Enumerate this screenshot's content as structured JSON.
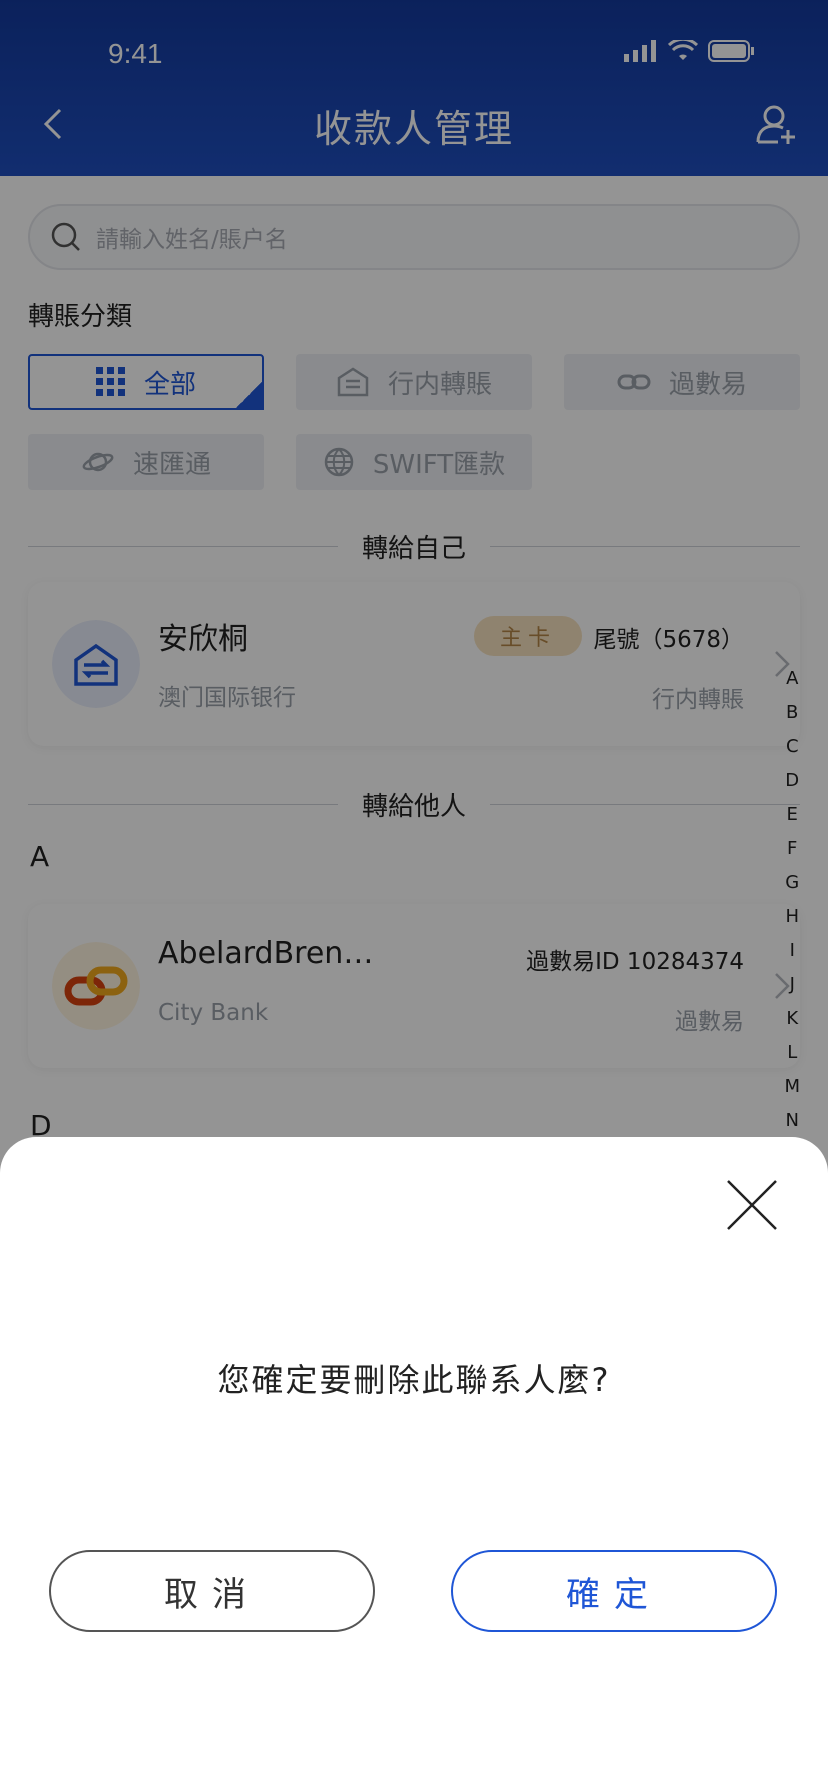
{
  "status": {
    "time": "9:41"
  },
  "nav": {
    "title": "收款人管理"
  },
  "search": {
    "placeholder": "請輸入姓名/賬户名"
  },
  "category": {
    "label": "轉賬分類",
    "chips": [
      {
        "label": "全部",
        "icon": "grid-icon",
        "active": true
      },
      {
        "label": "行内轉賬",
        "icon": "bank-transfer-icon",
        "active": false
      },
      {
        "label": "過數易",
        "icon": "link-icon",
        "active": false
      },
      {
        "label": "速匯通",
        "icon": "planet-icon",
        "active": false
      },
      {
        "label": "SWIFT匯款",
        "icon": "globe-icon",
        "active": false
      }
    ]
  },
  "self_section": {
    "title": "轉給自己",
    "card": {
      "name": "安欣桐",
      "badge": "主卡",
      "tail": "尾號（5678）",
      "bank": "澳门国际银行",
      "type": "行内轉賬"
    }
  },
  "others_section": {
    "title": "轉給他人",
    "groups": [
      {
        "letter": "A",
        "card": {
          "name": "AbelardBren…",
          "id_text": "過數易ID 10284374",
          "bank": "City Bank",
          "type": "過數易"
        }
      },
      {
        "letter": "D"
      }
    ]
  },
  "index_letters": [
    "A",
    "B",
    "C",
    "D",
    "E",
    "F",
    "G",
    "H",
    "I",
    "J",
    "K",
    "L",
    "M",
    "N"
  ],
  "dialog": {
    "question": "您確定要刪除此聯系人麼?",
    "cancel": "取消",
    "confirm": "確定"
  },
  "colors": {
    "brand": "#1f56d6",
    "header": "#143a9e",
    "badge_bg": "#f7e2bf"
  }
}
